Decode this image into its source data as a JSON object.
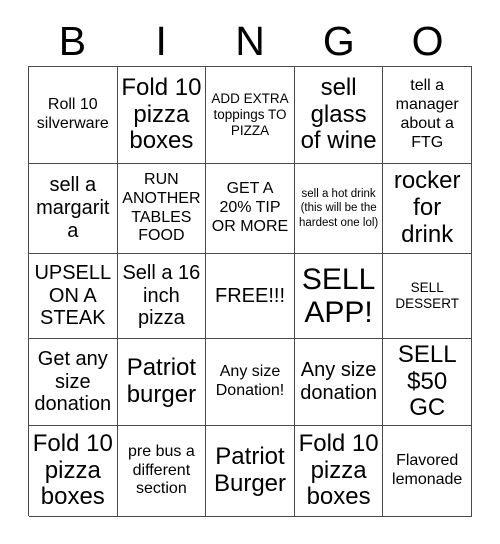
{
  "card": {
    "title": "BINGO",
    "header_letters": [
      "B",
      "I",
      "N",
      "G",
      "O"
    ],
    "rows": 5,
    "columns": 5,
    "free_space_index": 12,
    "colors": {
      "border": "#4a4a4a",
      "cell_background": "#ffffff",
      "text": "#000000",
      "page_background": "#ffffff"
    }
  },
  "cells": [
    {
      "text": "Roll 10 silverware",
      "size": "md"
    },
    {
      "text": "Fold 10 pizza boxes",
      "size": "xl"
    },
    {
      "text": "ADD EXTRA toppings TO PIZZA",
      "size": "sm"
    },
    {
      "text": "sell glass of wine",
      "size": "xl"
    },
    {
      "text": "tell a manager about a FTG",
      "size": "md"
    },
    {
      "text": "sell a margarita",
      "size": "lg"
    },
    {
      "text": "RUN ANOTHER TABLES FOOD",
      "size": "md"
    },
    {
      "text": "GET A 20% TIP OR MORE",
      "size": "md"
    },
    {
      "text": "sell a hot drink (this will be the hardest one lol)",
      "size": "xs"
    },
    {
      "text": "rocker for drink",
      "size": "xl"
    },
    {
      "text": "UPSELL ON A STEAK",
      "size": "lg"
    },
    {
      "text": "Sell a 16 inch pizza",
      "size": "lg"
    },
    {
      "text": "FREE!!!",
      "size": "lg"
    },
    {
      "text": "SELL APP!",
      "size": "xxl"
    },
    {
      "text": "SELL DESSERT",
      "size": "sm"
    },
    {
      "text": "Get any size donation",
      "size": "lg"
    },
    {
      "text": "Patriot burger",
      "size": "xl"
    },
    {
      "text": "Any size Donation!",
      "size": "md"
    },
    {
      "text": "Any size donation",
      "size": "lg"
    },
    {
      "text": "SELL $50 GC",
      "size": "xl"
    },
    {
      "text": "Fold 10 pizza boxes",
      "size": "xl"
    },
    {
      "text": "pre bus a different section",
      "size": "md"
    },
    {
      "text": "Patriot Burger",
      "size": "xl"
    },
    {
      "text": "Fold 10 pizza boxes",
      "size": "xl"
    },
    {
      "text": "Flavored lemonade",
      "size": "md"
    }
  ]
}
